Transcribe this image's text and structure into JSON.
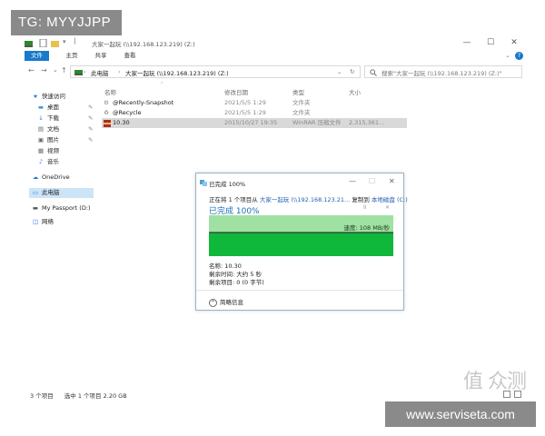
{
  "watermarks": {
    "tg": "TG: MYYJJPP",
    "site": "www.serviseta.com",
    "zhi": "值 众测"
  },
  "window": {
    "title": "大家一起玩 (\\\\192.168.123.219) (Z:)",
    "controls": {
      "minimize": "—",
      "maximize": "☐",
      "close": "✕"
    }
  },
  "ribbon": {
    "tabs": [
      "文件",
      "主页",
      "共享",
      "查看"
    ],
    "help": "?"
  },
  "address": {
    "back": "←",
    "forward": "→",
    "up_dropdown": "⌄",
    "up": "↑",
    "crumb_1": "此电脑",
    "crumb_2": "大家一起玩 (\\\\192.168.123.219) (Z:)",
    "refresh": "↻",
    "search_placeholder": "搜索\"大家一起玩 (\\\\192.168.123.219) (Z:)\""
  },
  "sidebar": {
    "items": [
      {
        "label": "快速访问",
        "icon": "★"
      },
      {
        "label": "桌面",
        "icon": "▬"
      },
      {
        "label": "下载",
        "icon": "↓"
      },
      {
        "label": "文档",
        "icon": "▤"
      },
      {
        "label": "图片",
        "icon": "▣"
      },
      {
        "label": "视频",
        "icon": "▦"
      },
      {
        "label": "音乐",
        "icon": "♪"
      },
      {
        "label": "OneDrive",
        "icon": "☁"
      },
      {
        "label": "此电脑",
        "icon": "▭"
      },
      {
        "label": "My Passport (D:)",
        "icon": "▬"
      },
      {
        "label": "网络",
        "icon": "◫"
      }
    ]
  },
  "columns": {
    "name": "名称",
    "date": "修改日期",
    "type": "类型",
    "size": "大小"
  },
  "files": [
    {
      "name": "@Recently-Snapshot",
      "date": "2021/5/5 1:29",
      "type": "文件夹",
      "size": ""
    },
    {
      "name": "@Recycle",
      "date": "2021/5/5 1:29",
      "type": "文件夹",
      "size": ""
    },
    {
      "name": "10.30",
      "date": "2015/10/27 19:35",
      "type": "WinRAR 压缩文件",
      "size": "2,315,361..."
    }
  ],
  "dialog": {
    "title": "已完成 100%",
    "line_prefix": "正在将 1 个项目从",
    "line_source": "大家一起玩 (\\\\192.168.123.21...",
    "line_mid": "复制到",
    "line_dest": "本地磁盘 (C:)",
    "percent": "已完成 100%",
    "speed": "速度: 108 MB/秒",
    "name_line": "名称: 10.30",
    "time_line": "剩余时间: 大约 5 秒",
    "items_line": "剩余项目: 0 (0 字节)",
    "detail_button": "简略信息",
    "pause_icon": "II",
    "cancel_icon": "✕",
    "progress": 1.0
  },
  "status": {
    "count": "3 个项目",
    "selected": "选中 1 个项目  2.20 GB"
  }
}
